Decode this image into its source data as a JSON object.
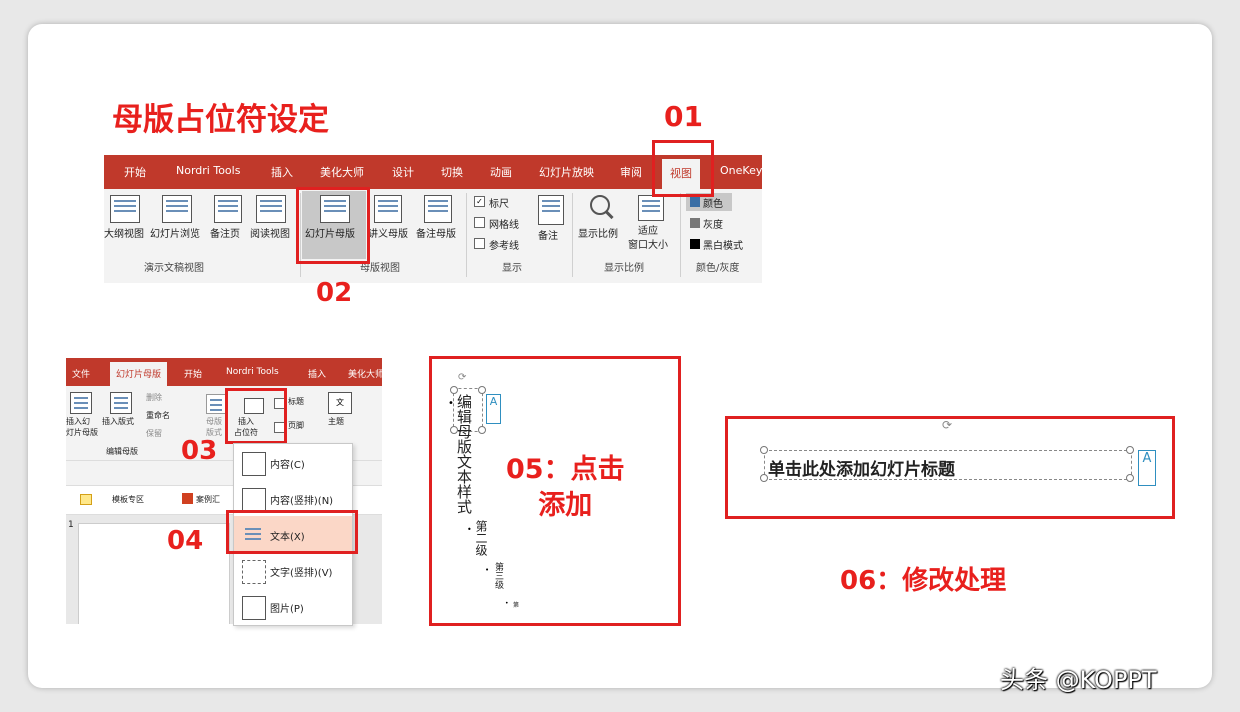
{
  "heading": "母版占位符设定",
  "steps": {
    "s01": "01",
    "s02": "02",
    "s03": "03",
    "s04": "04",
    "s05": "05：点击\n添加",
    "s06": "06：修改处理"
  },
  "ribbon1": {
    "tabs": [
      "开始",
      "Nordri Tools",
      "插入",
      "美化大师",
      "设计",
      "切换",
      "动画",
      "幻灯片放映",
      "审阅",
      "视图",
      "OneKey"
    ],
    "active_tab": "视图",
    "buttons": [
      "大纲视图",
      "幻灯片浏览",
      "备注页",
      "阅读视图",
      "幻灯片母版",
      "讲义母版",
      "备注母版",
      "备注",
      "显示比例",
      "适应\n窗口大小"
    ],
    "checks": [
      "标尺",
      "网格线",
      "参考线"
    ],
    "color_items": [
      "颜色",
      "灰度",
      "黑白模式"
    ],
    "groups": [
      "演示文稿视图",
      "母版视图",
      "显示",
      "显示比例",
      "颜色/灰度"
    ]
  },
  "ribbon2": {
    "tabs": [
      "文件",
      "幻灯片母版",
      "开始",
      "Nordri Tools",
      "插入",
      "美化大师"
    ],
    "active_tab": "幻灯片母版",
    "buttons": [
      "插入幻\n灯片母版",
      "插入版式",
      "删除",
      "重命名",
      "保留",
      "母版\n版式",
      "插入\n占位符",
      "标题",
      "页脚",
      "主题"
    ],
    "group_label": "编辑母版",
    "quick_links": [
      "模板专区",
      "案例汇"
    ],
    "row_number": "1"
  },
  "menu_items": [
    "内容(C)",
    "内容(竖排)(N)",
    "文本(X)",
    "文字(竖排)(V)",
    "图片(P)"
  ],
  "selected_menu_item": "文本(X)",
  "vertical_text": {
    "main": "编辑母版文本样式",
    "level2": "第二级",
    "level3": "第三级",
    "level4": "第"
  },
  "title_placeholder": "单击此处添加幻灯片标题",
  "autofit_label": "A",
  "watermark": "头条 @KOPPT",
  "colors": {
    "accent_red": "#e02020",
    "tab_red": "#c0392b",
    "highlight": "#fbd7c7"
  }
}
